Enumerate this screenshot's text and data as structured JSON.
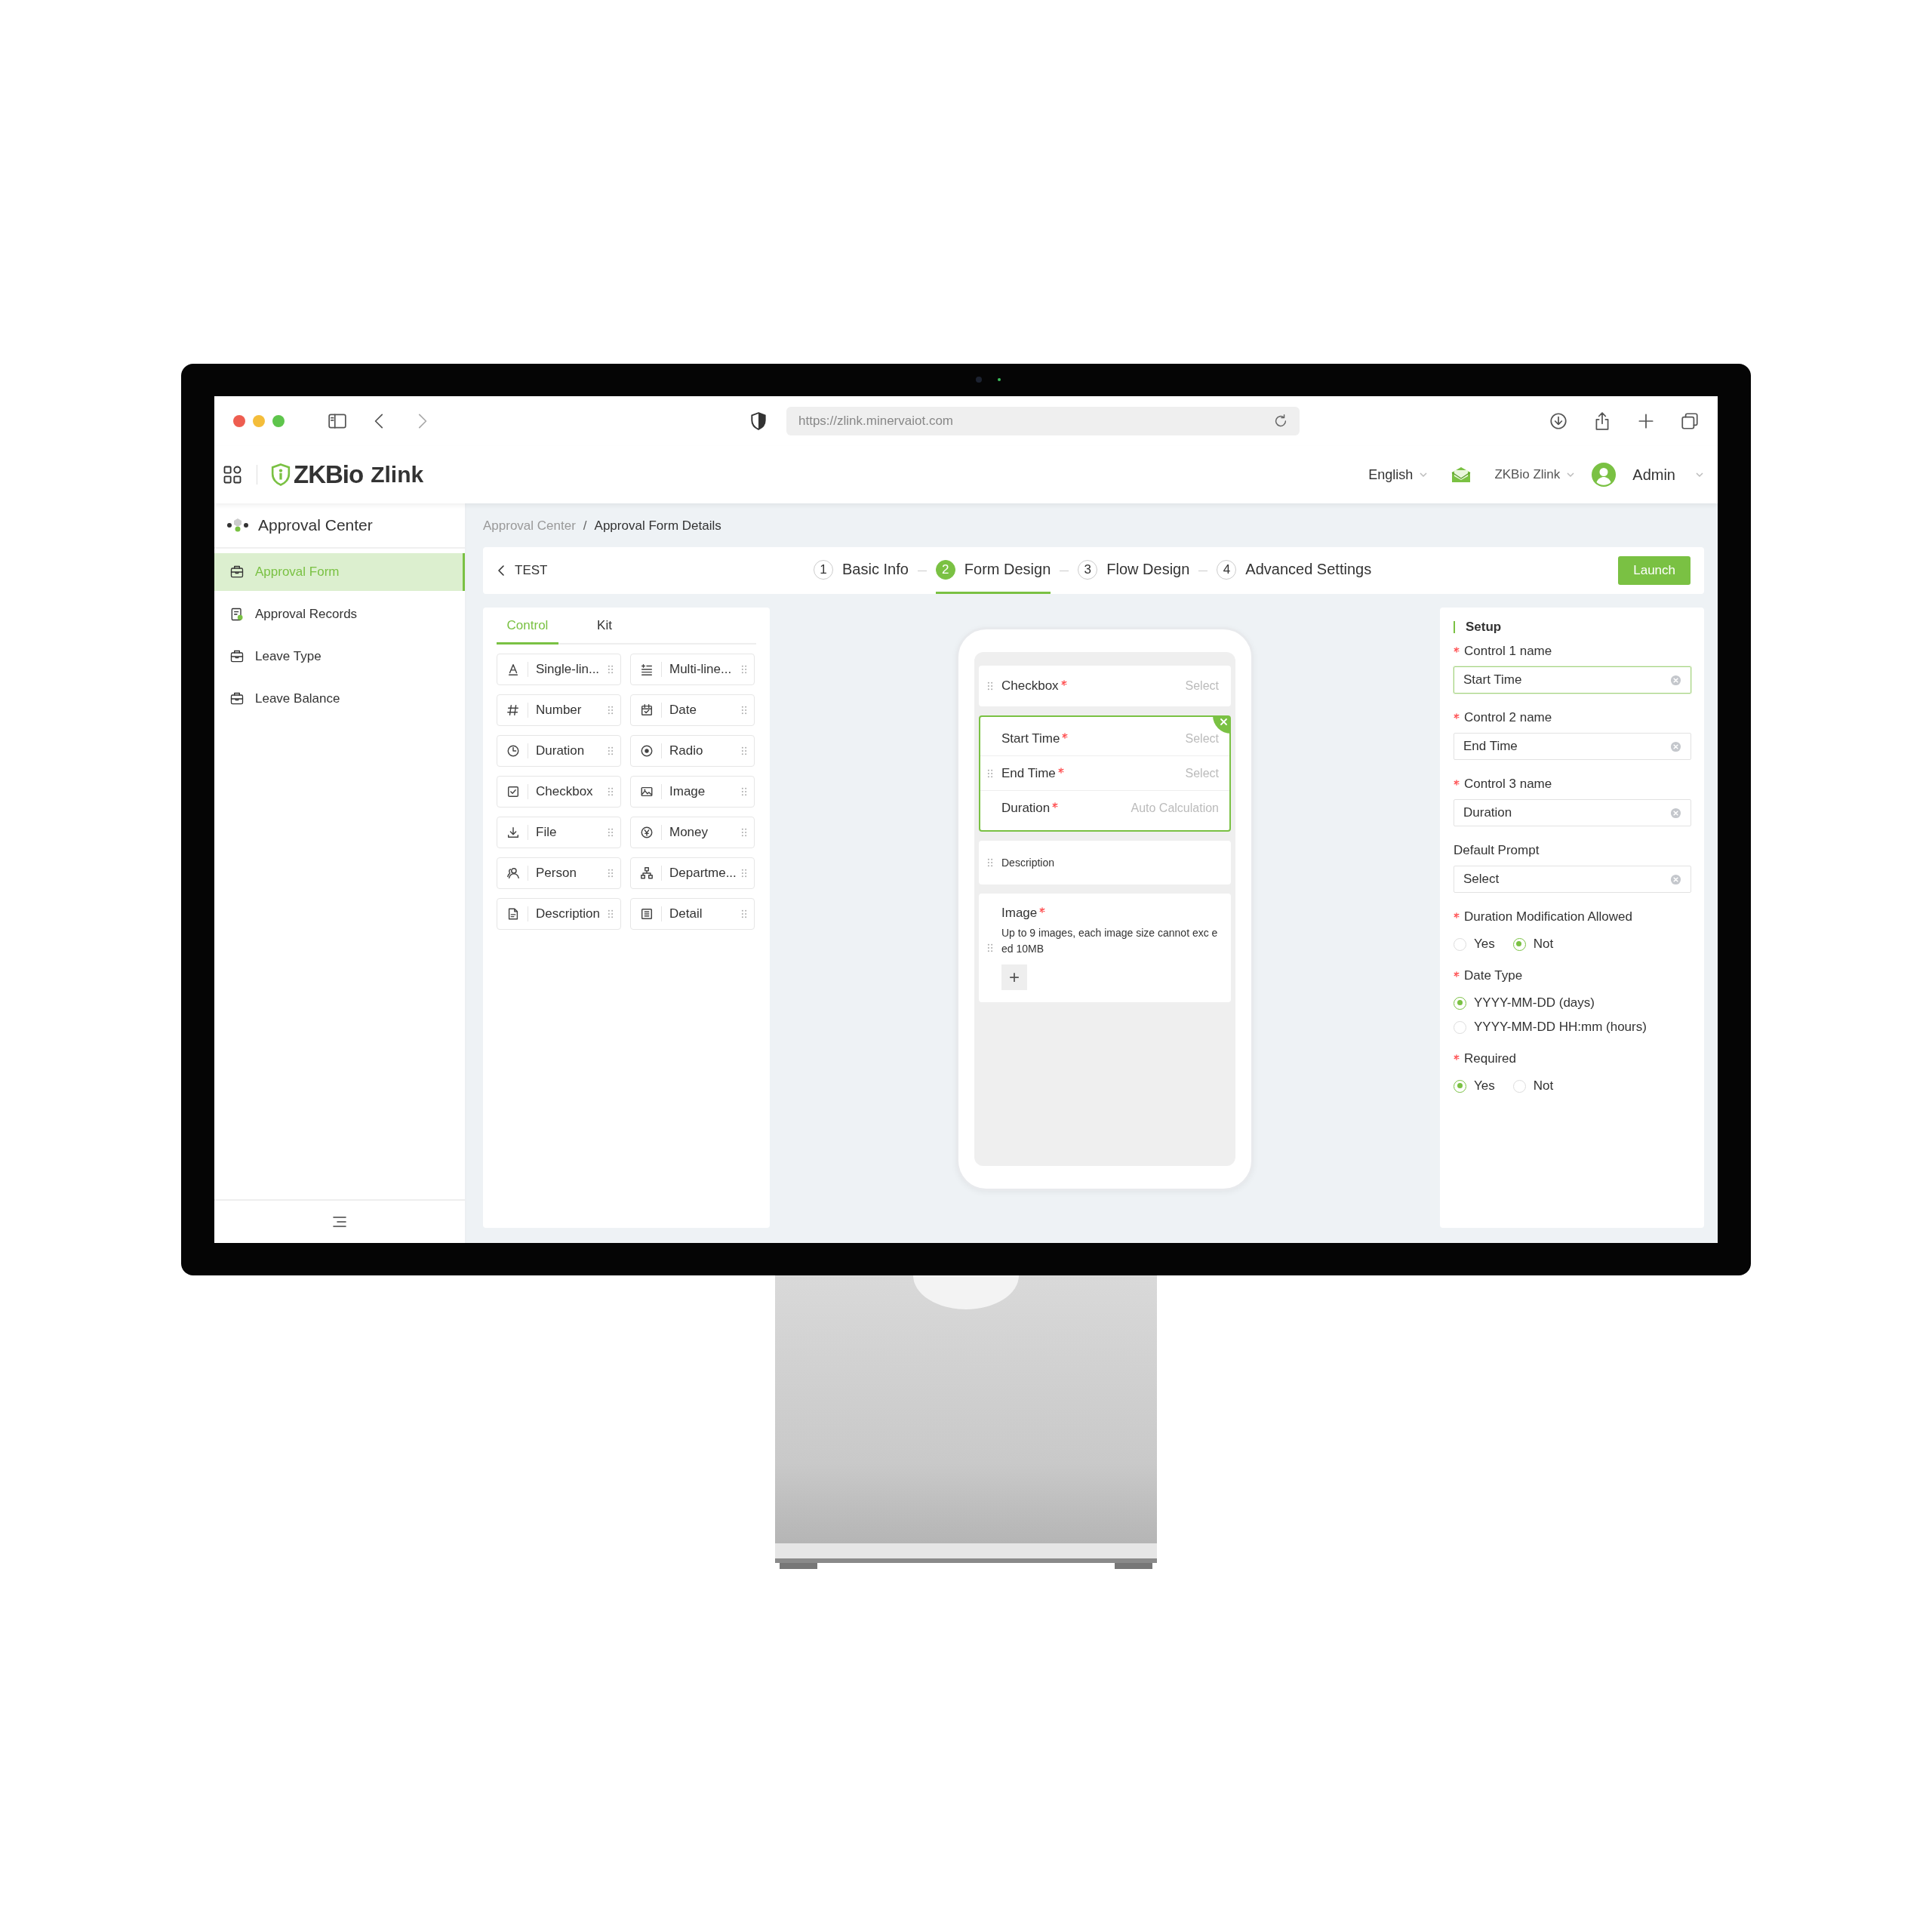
{
  "browser": {
    "url": "https://zlink.minervaiot.com"
  },
  "header": {
    "brand": "ZKBio",
    "product": "Zlink",
    "language": "English",
    "organization": "ZKBio Zlink",
    "user": "Admin"
  },
  "sidebar": {
    "title": "Approval Center",
    "items": [
      {
        "label": "Approval Form",
        "kind": "form",
        "selected": true
      },
      {
        "label": "Approval Records",
        "kind": "records",
        "selected": false
      },
      {
        "label": "Leave Type",
        "kind": "form",
        "selected": false
      },
      {
        "label": "Leave Balance",
        "kind": "form",
        "selected": false
      }
    ]
  },
  "breadcrumb_separator": "/",
  "breadcrumb": [
    {
      "label": "Approval Center",
      "current": false
    },
    {
      "label": "Approval Form Details",
      "current": true
    }
  ],
  "form_title": "TEST",
  "steps": [
    {
      "number": "1",
      "label": "Basic Info",
      "selected": false
    },
    {
      "number": "2",
      "label": "Form Design",
      "selected": true
    },
    {
      "number": "3",
      "label": "Flow Design",
      "selected": false
    },
    {
      "number": "4",
      "label": "Advanced Settings",
      "selected": false
    }
  ],
  "launch_button": "Launch",
  "control_panel": {
    "tabs": [
      {
        "label": "Control",
        "selected": true
      },
      {
        "label": "Kit",
        "selected": false
      }
    ],
    "controls": [
      {
        "label": "Single-lin...",
        "kind": "text"
      },
      {
        "label": "Multi-line...",
        "kind": "multiline"
      },
      {
        "label": "Number",
        "kind": "number"
      },
      {
        "label": "Date",
        "kind": "date"
      },
      {
        "label": "Duration",
        "kind": "duration"
      },
      {
        "label": "Radio",
        "kind": "radio"
      },
      {
        "label": "Checkbox",
        "kind": "checkbox"
      },
      {
        "label": "Image",
        "kind": "image"
      },
      {
        "label": "File",
        "kind": "file"
      },
      {
        "label": "Money",
        "kind": "money"
      },
      {
        "label": "Person",
        "kind": "person"
      },
      {
        "label": "Departme...",
        "kind": "department"
      },
      {
        "label": "Description",
        "kind": "description"
      },
      {
        "label": "Detail",
        "kind": "detail"
      }
    ]
  },
  "canvas": {
    "fields": [
      {
        "kind": "single",
        "selected": false,
        "label": "Checkbox",
        "required": true,
        "placeholder": "Select"
      },
      {
        "kind": "group",
        "selected": true,
        "rows": [
          {
            "label": "Start Time",
            "required": true,
            "placeholder": "Select"
          },
          {
            "label": "End Time",
            "required": true,
            "placeholder": "Select"
          },
          {
            "label": "Duration",
            "required": true,
            "placeholder": "Auto Calculation"
          }
        ]
      },
      {
        "kind": "description",
        "selected": false,
        "label": "Description"
      },
      {
        "kind": "image",
        "selected": false,
        "label": "Image",
        "required": true,
        "hint": "Up to 9 images, each image size cannot exc eed 10MB",
        "add_button": "+"
      }
    ]
  },
  "setup": {
    "title": "Setup",
    "groups": [
      {
        "kind": "input",
        "label": "Control 1 name",
        "required": true,
        "value": "Start Time",
        "focused": true
      },
      {
        "kind": "input",
        "label": "Control 2 name",
        "required": true,
        "value": "End Time",
        "focused": false
      },
      {
        "kind": "input",
        "label": "Control 3 name",
        "required": true,
        "value": "Duration",
        "focused": false
      },
      {
        "kind": "input",
        "label": "Default Prompt",
        "required": false,
        "value": "Select",
        "focused": false
      },
      {
        "kind": "radio",
        "label": "Duration Modification Allowed",
        "required": true,
        "inline": true,
        "options": [
          {
            "label": "Yes",
            "selected": false
          },
          {
            "label": "Not",
            "selected": true
          }
        ]
      },
      {
        "kind": "radio",
        "label": "Date Type",
        "required": true,
        "inline": false,
        "options": [
          {
            "label": "YYYY-MM-DD (days)",
            "selected": true
          },
          {
            "label": "YYYY-MM-DD HH:mm (hours)",
            "selected": false
          }
        ]
      },
      {
        "kind": "radio",
        "label": "Required",
        "required": true,
        "inline": true,
        "options": [
          {
            "label": "Yes",
            "selected": true
          },
          {
            "label": "Not",
            "selected": false
          }
        ]
      }
    ]
  }
}
